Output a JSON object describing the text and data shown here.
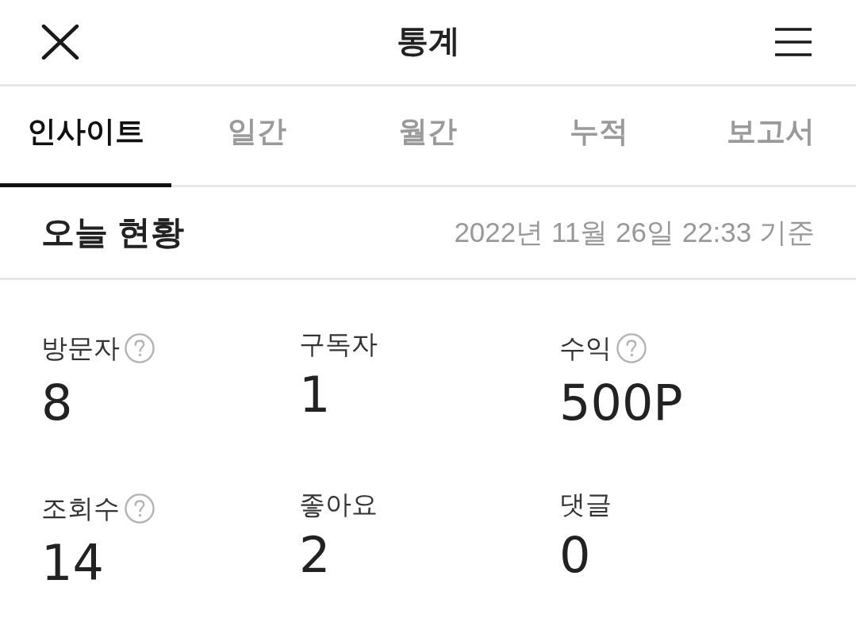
{
  "header": {
    "title": "통계"
  },
  "tabs": [
    {
      "label": "인사이트",
      "selected": true
    },
    {
      "label": "일간",
      "selected": false
    },
    {
      "label": "월간",
      "selected": false
    },
    {
      "label": "누적",
      "selected": false
    },
    {
      "label": "보고서",
      "selected": false
    }
  ],
  "today": {
    "title": "오늘 현황",
    "timestamp": "2022년 11월 26일 22:33 기준",
    "stats": [
      {
        "label": "방문자",
        "value": "8",
        "help": true
      },
      {
        "label": "구독자",
        "value": "1",
        "help": false
      },
      {
        "label": "수익",
        "value": "500P",
        "help": true
      },
      {
        "label": "조회수",
        "value": "14",
        "help": true
      },
      {
        "label": "좋아요",
        "value": "2",
        "help": false
      },
      {
        "label": "댓글",
        "value": "0",
        "help": false
      }
    ]
  }
}
